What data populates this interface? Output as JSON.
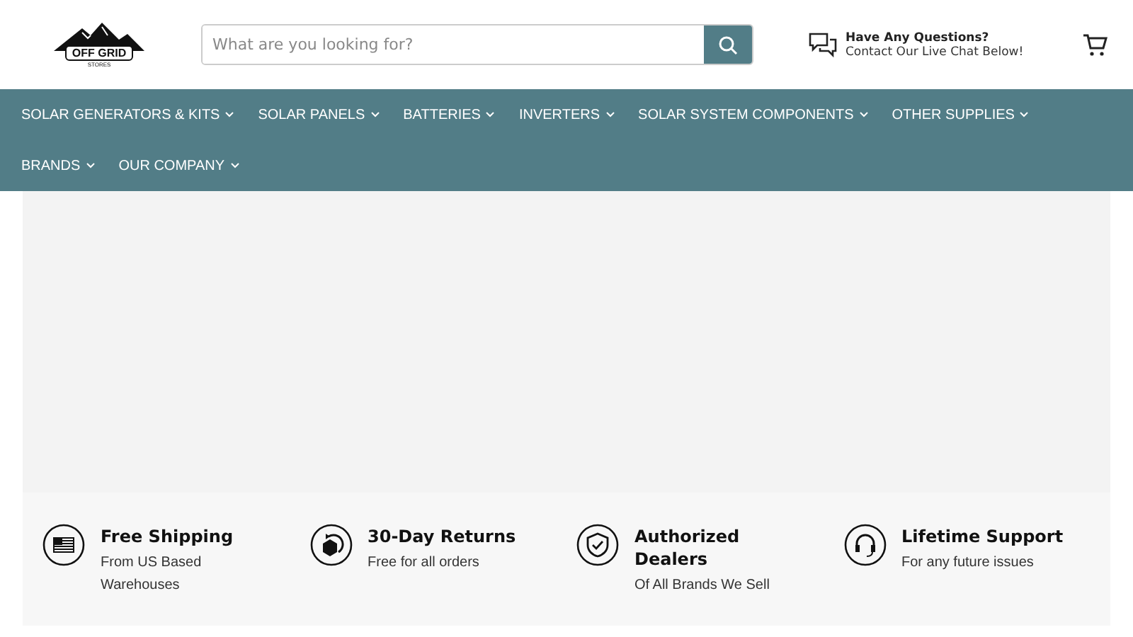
{
  "header": {
    "logo": {
      "title": "OFF GRID",
      "subtitle": "STORES"
    },
    "search": {
      "placeholder": "What are you looking for?"
    },
    "help": {
      "title": "Have Any Questions?",
      "subtitle": "Contact Our Live Chat Below!"
    }
  },
  "nav": [
    {
      "label": "SOLAR GENERATORS & KITS"
    },
    {
      "label": "SOLAR PANELS"
    },
    {
      "label": "BATTERIES"
    },
    {
      "label": "INVERTERS"
    },
    {
      "label": "SOLAR SYSTEM COMPONENTS"
    },
    {
      "label": "OTHER SUPPLIES"
    },
    {
      "label": "BRANDS"
    },
    {
      "label": "OUR COMPANY"
    }
  ],
  "features": [
    {
      "kind": "flag",
      "title": "Free Shipping",
      "text": "From US Based Warehouses"
    },
    {
      "kind": "returns",
      "title": "30-Day Returns",
      "text": "Free for all orders"
    },
    {
      "kind": "shield",
      "title": "Authorized Dealers",
      "text": "Of All Brands We Sell"
    },
    {
      "kind": "headset",
      "title": "Lifetime Support",
      "text": "For any future issues"
    }
  ]
}
